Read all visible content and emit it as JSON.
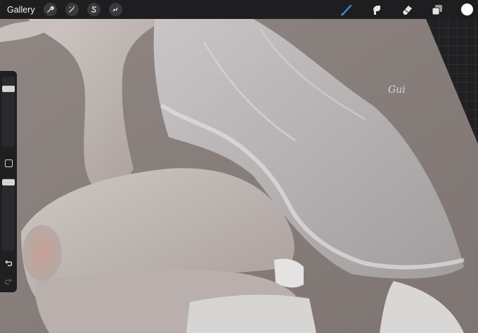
{
  "topbar": {
    "gallery_label": "Gallery",
    "tools": [
      {
        "icon": "wrench-icon"
      },
      {
        "icon": "magic-wand-icon"
      },
      {
        "icon": "selection-s-icon"
      },
      {
        "icon": "transform-arrow-icon"
      }
    ],
    "right_tools": [
      {
        "icon": "brush-icon",
        "active": true,
        "color": "#3b8ff5"
      },
      {
        "icon": "smudge-icon"
      },
      {
        "icon": "eraser-icon"
      },
      {
        "icon": "layers-icon"
      }
    ],
    "current_color": "#ffffff"
  },
  "sidebar": {
    "brush_size_level": 0.86,
    "opacity_level": 0.98,
    "modify_icon": "square-icon",
    "undo_icon": "undo-icon",
    "redo_icon": "redo-icon"
  },
  "canvas": {
    "signature_text": "Gui"
  }
}
